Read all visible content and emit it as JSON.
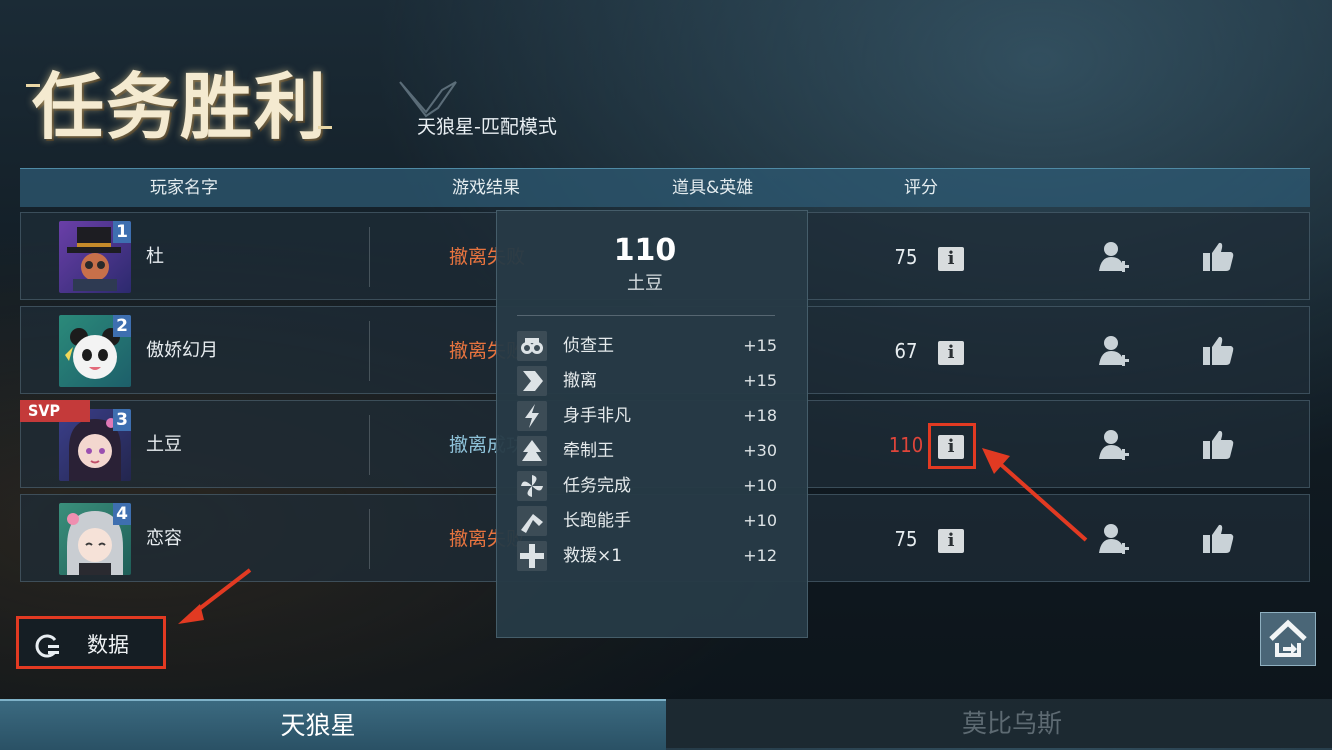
{
  "header": {
    "title": "任务胜利",
    "mode": "天狼星-匹配模式"
  },
  "table": {
    "columns": [
      "玩家名字",
      "游戏结果",
      "道具&英雄",
      "评分"
    ],
    "rows": [
      {
        "rank": "1",
        "name": "杜",
        "result": "撤离失败",
        "score": "75",
        "result_color": "#e8743f"
      },
      {
        "rank": "2",
        "name": "傲娇幻月",
        "result": "撤离失败",
        "score": "67",
        "result_color": "#e8743f"
      },
      {
        "rank": "3",
        "name": "土豆",
        "result": "撤离成功",
        "score": "110",
        "result_color": "#8fc3da",
        "svp": "SVP"
      },
      {
        "rank": "4",
        "name": "恋容",
        "result": "撤离失败",
        "score": "75",
        "result_color": "#e8743f"
      }
    ],
    "info_label": "i"
  },
  "popup": {
    "score": "110",
    "name": "土豆",
    "bonuses": [
      {
        "label": "侦查王",
        "value": "+15",
        "icon": "binoculars-icon"
      },
      {
        "label": "撤离",
        "value": "+15",
        "icon": "evacuate-arrow-icon"
      },
      {
        "label": "身手非凡",
        "value": "+18",
        "icon": "lightning-icon"
      },
      {
        "label": "牵制王",
        "value": "+30",
        "icon": "tree-icon"
      },
      {
        "label": "任务完成",
        "value": "+10",
        "icon": "pinwheel-icon"
      },
      {
        "label": "长跑能手",
        "value": "+10",
        "icon": "runner-icon"
      },
      {
        "label": "救援×1",
        "value": "+12",
        "icon": "plus-cross-icon"
      }
    ]
  },
  "footer": {
    "data_button": "数据",
    "tab_left": "天狼星",
    "tab_right": "莫比乌斯"
  },
  "colors": {
    "accent_red": "#e23a22",
    "score_highlight": "#e0453a",
    "fail": "#e8743f",
    "success": "#8fc3da"
  }
}
